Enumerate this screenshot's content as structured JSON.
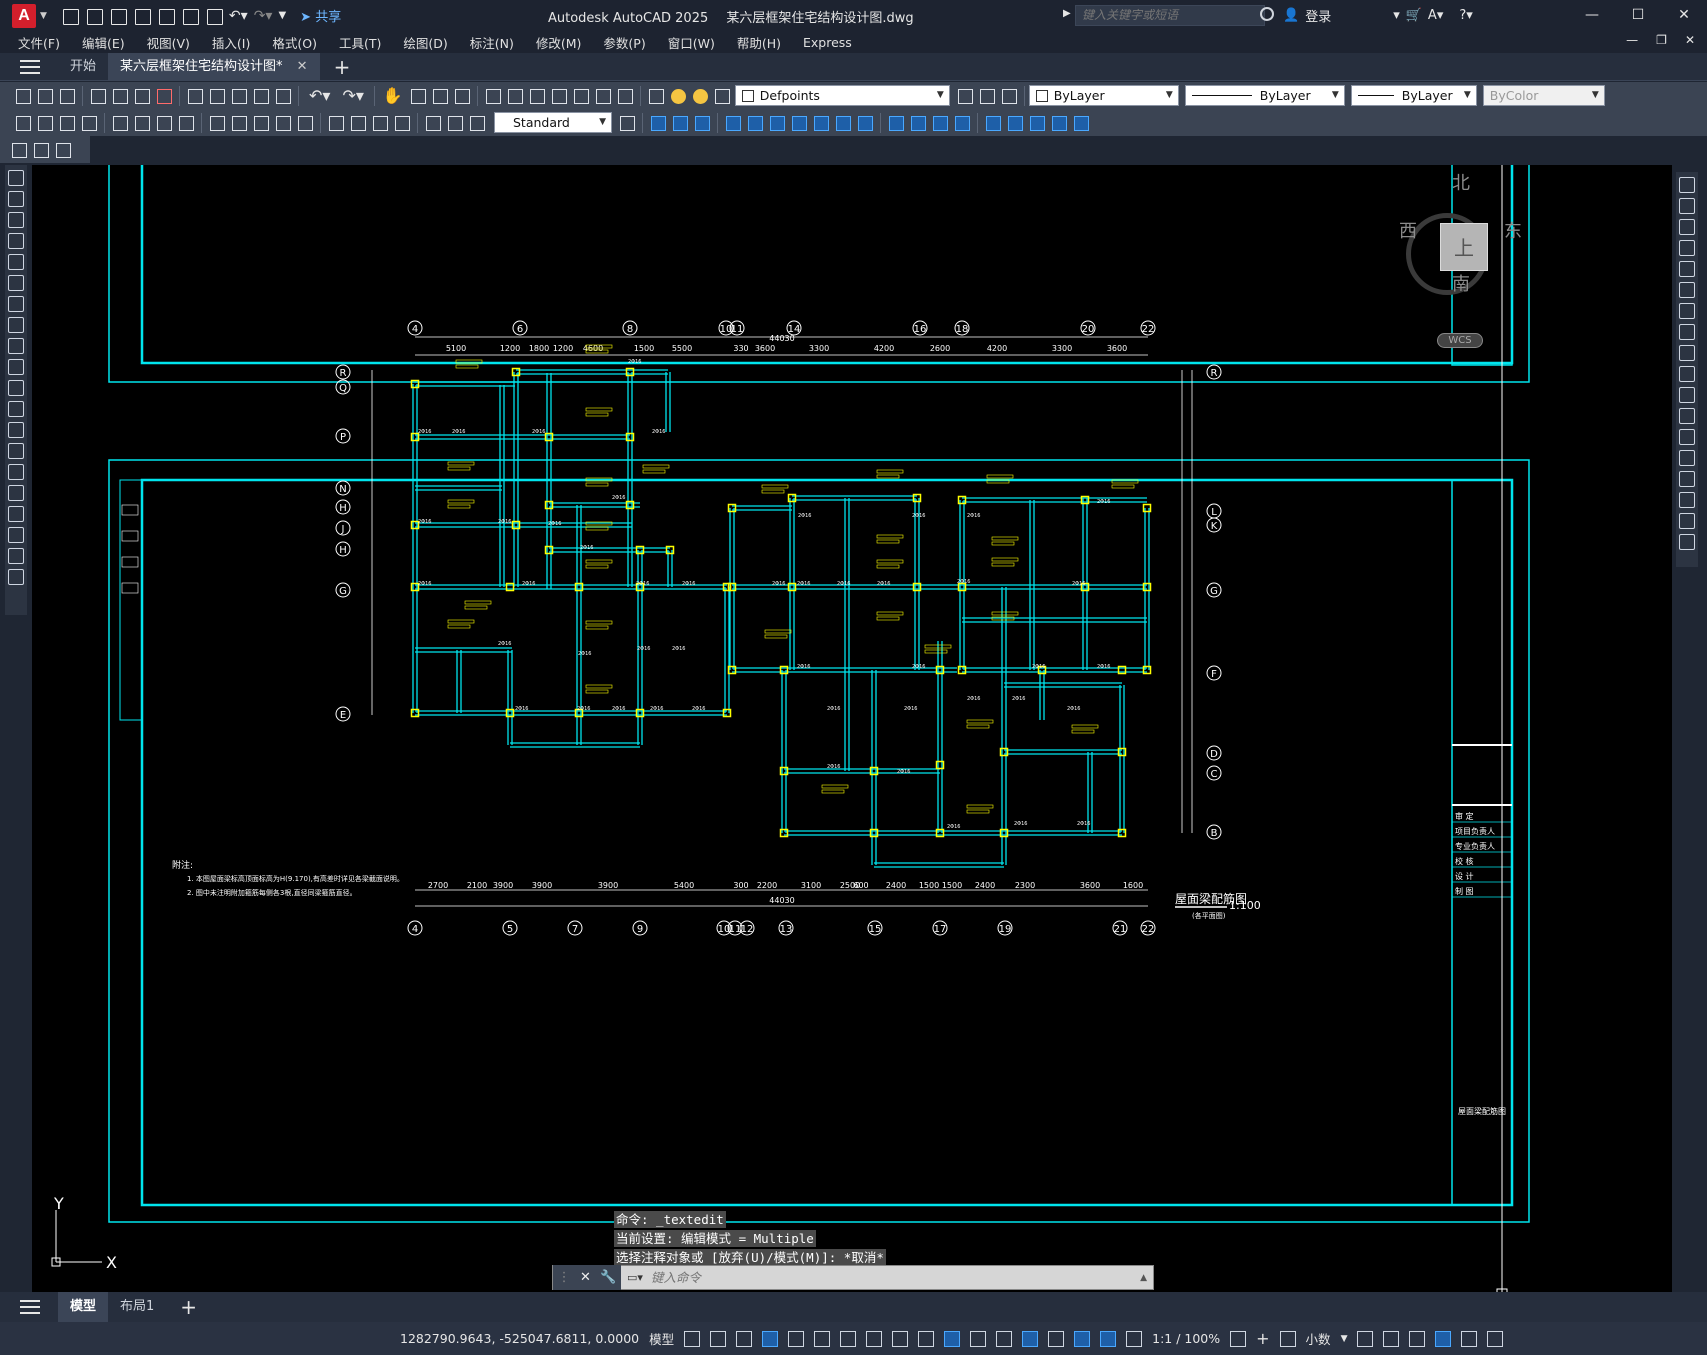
{
  "window": {
    "app_name": "Autodesk AutoCAD 2025",
    "file_name": "某六层框架住宅结构设计图.dwg",
    "share_label": "共享",
    "search_placeholder": "键入关键字或短语",
    "login_label": "登录"
  },
  "menu": [
    "文件(F)",
    "编辑(E)",
    "视图(V)",
    "插入(I)",
    "格式(O)",
    "工具(T)",
    "绘图(D)",
    "标注(N)",
    "修改(M)",
    "参数(P)",
    "窗口(W)",
    "帮助(H)",
    "Express"
  ],
  "tabs": {
    "start": "开始",
    "document": "某六层框架住宅结构设计图*"
  },
  "toolbar": {
    "layer_name": "Defpoints",
    "color": "ByLayer",
    "linetype": "ByLayer",
    "lineweight": "ByLayer",
    "plotstyle": "ByColor",
    "text_style": "Standard"
  },
  "viewcube": {
    "north": "北",
    "south": "南",
    "east": "东",
    "west": "西",
    "top": "上",
    "wcs": "WCS"
  },
  "drawing": {
    "grid_top": [
      "4",
      "6",
      "8",
      "10",
      "11",
      "14",
      "16",
      "18",
      "20",
      "22"
    ],
    "grid_bottom": [
      "4",
      "5",
      "7",
      "9",
      "10",
      "11",
      "12",
      "13",
      "15",
      "17",
      "19",
      "21",
      "22"
    ],
    "grid_left": [
      "R",
      "Q",
      "P",
      "N",
      "H",
      "J",
      "H",
      "G",
      "E"
    ],
    "grid_right": [
      "R",
      "L",
      "K",
      "G",
      "F",
      "D",
      "C",
      "B"
    ],
    "dims_top": [
      "5100",
      "1200",
      "1800",
      "1200",
      "4600",
      "1500",
      "5500",
      "330",
      "3600",
      "3300",
      "4200",
      "2600",
      "4200",
      "3300",
      "3600"
    ],
    "dims_bottom": [
      "2700",
      "2100",
      "3900",
      "3900",
      "3900",
      "5400",
      "300",
      "2200",
      "3100",
      "2500",
      "600",
      "2400",
      "1500",
      "1500",
      "2400",
      "2300",
      "3600",
      "1600"
    ],
    "total_dim": "44030",
    "sheet_title": "屋面梁配筋图",
    "sheet_sub": "(各平面图)",
    "scale": "1:100",
    "notes_title": "附注:",
    "note1": "1. 本图屋面梁标高顶面标高为H(9.170),有高差时详见各梁截面说明。",
    "note2": "2. 图中未注明附加箍筋每侧各3根,直径同梁箍筋直径。",
    "title_block": [
      "审 定",
      "项目负责人",
      "专业负责人",
      "校 核",
      "设 计",
      "制 图"
    ]
  },
  "command": {
    "line1": "命令: _textedit",
    "line2": "当前设置: 编辑模式 = Multiple",
    "line3": "选择注释对象或 [放弃(U)/模式(M)]: *取消*",
    "placeholder": "键入命令"
  },
  "layout_tabs": [
    "模型",
    "布局1"
  ],
  "status": {
    "coords": "1282790.9643, -525047.6811, 0.0000",
    "mode": "模型",
    "scale": "1:1 / 100%",
    "units": "小数"
  },
  "colors": {
    "accent": "#00e5ee",
    "column": "#ffff00",
    "text_yellow": "#ffff00",
    "background": "#000000"
  }
}
